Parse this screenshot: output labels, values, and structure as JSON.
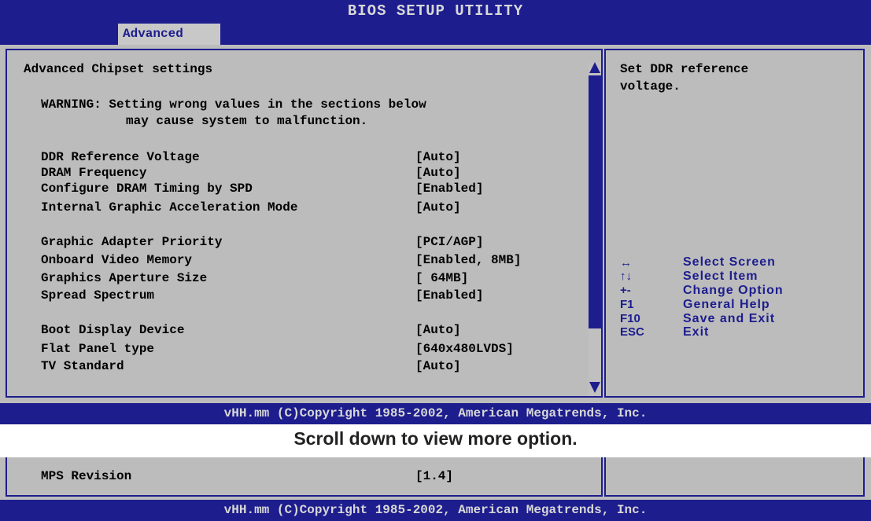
{
  "header": {
    "title": "BIOS SETUP UTILITY",
    "active_tab": "Advanced"
  },
  "main": {
    "heading": "Advanced Chipset settings",
    "warning_line1": "WARNING: Setting wrong values in the sections below",
    "warning_line2": "may cause system to malfunction.",
    "settings": [
      {
        "label": "DDR Reference Voltage",
        "value": "[Auto]"
      },
      {
        "label": "DRAM Frequency",
        "value": "[Auto]"
      },
      {
        "label": "Configure DRAM Timing by SPD",
        "value": "[Enabled]"
      },
      {
        "label": "Internal Graphic Acceleration Mode",
        "value": "[Auto]"
      },
      {
        "label": "Graphic Adapter Priority",
        "value": "[PCI/AGP]"
      },
      {
        "label": "Onboard Video Memory",
        "value": "[Enabled, 8MB]"
      },
      {
        "label": "Graphics Aperture Size",
        "value": "[ 64MB]"
      },
      {
        "label": "Spread Spectrum",
        "value": "[Enabled]"
      },
      {
        "label": "Boot Display Device",
        "value": "[Auto]"
      },
      {
        "label": "Flat Panel type",
        "value": "[640x480LVDS]"
      },
      {
        "label": "TV Standard",
        "value": "[Auto]"
      }
    ]
  },
  "help": {
    "text_line1": "Set DDR reference",
    "text_line2": "voltage.",
    "keys": [
      {
        "key": "↔",
        "desc": "Select Screen"
      },
      {
        "key": "↑↓",
        "desc": "Select Item"
      },
      {
        "key": "+-",
        "desc": "Change Option"
      },
      {
        "key": "F1",
        "desc": "General Help"
      },
      {
        "key": "F10",
        "desc": "Save and Exit"
      },
      {
        "key": "ESC",
        "desc": "Exit"
      }
    ]
  },
  "footer": {
    "copyright": "vHH.mm (C)Copyright 1985-2002, American Megatrends, Inc."
  },
  "caption": "Scroll down to view more option.",
  "lower": {
    "label": "MPS Revision",
    "value": "[1.4]"
  },
  "colors": {
    "bios_blue": "#1d1d8e",
    "panel_gray": "#bcbcbc"
  }
}
